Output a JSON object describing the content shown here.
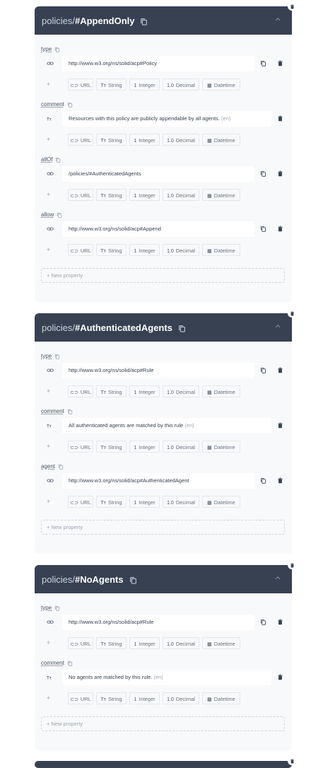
{
  "type_buttons": [
    {
      "glyph": "⊂⊃",
      "label": "URL"
    },
    {
      "glyph": "Tт",
      "label": "String"
    },
    {
      "glyph": "1",
      "label": "Integer"
    },
    {
      "glyph": "1.0",
      "label": "Decimal"
    },
    {
      "glyph": "▦",
      "label": "Datetime"
    }
  ],
  "new_property_label": "+ New property",
  "cards": [
    {
      "title_prefix": "policies/",
      "title_name": "#AppendOnly",
      "properties": [
        {
          "label": "type",
          "value": "http://www.w3.org/ns/solid/acp#Policy",
          "lang": "",
          "kind": "url"
        },
        {
          "label": "comment",
          "value": "Resources with this policy are publicly appendable by all agents.",
          "lang": "(en)",
          "kind": "text"
        },
        {
          "label": "allOf",
          "value": "/policies/#AuthenticatedAgents",
          "lang": "",
          "kind": "url"
        },
        {
          "label": "allow",
          "value": "http://www.w3.org/ns/solid/acp#Append",
          "lang": "",
          "kind": "url"
        }
      ]
    },
    {
      "title_prefix": "policies/",
      "title_name": "#AuthenticatedAgents",
      "properties": [
        {
          "label": "type",
          "value": "http://www.w3.org/ns/solid/acp#Rule",
          "lang": "",
          "kind": "url"
        },
        {
          "label": "comment",
          "value": "All authenticated agents are matched by this rule",
          "lang": "(en)",
          "kind": "text"
        },
        {
          "label": "agent",
          "value": "http://www.w3.org/ns/solid/acp#AuthenticatedAgent",
          "lang": "",
          "kind": "url"
        }
      ]
    },
    {
      "title_prefix": "policies/",
      "title_name": "#NoAgents",
      "properties": [
        {
          "label": "type",
          "value": "http://www.w3.org/ns/solid/acp#Rule",
          "lang": "",
          "kind": "url"
        },
        {
          "label": "comment",
          "value": "No agents are matched by this rule.",
          "lang": "(en)",
          "kind": "text"
        }
      ]
    }
  ]
}
